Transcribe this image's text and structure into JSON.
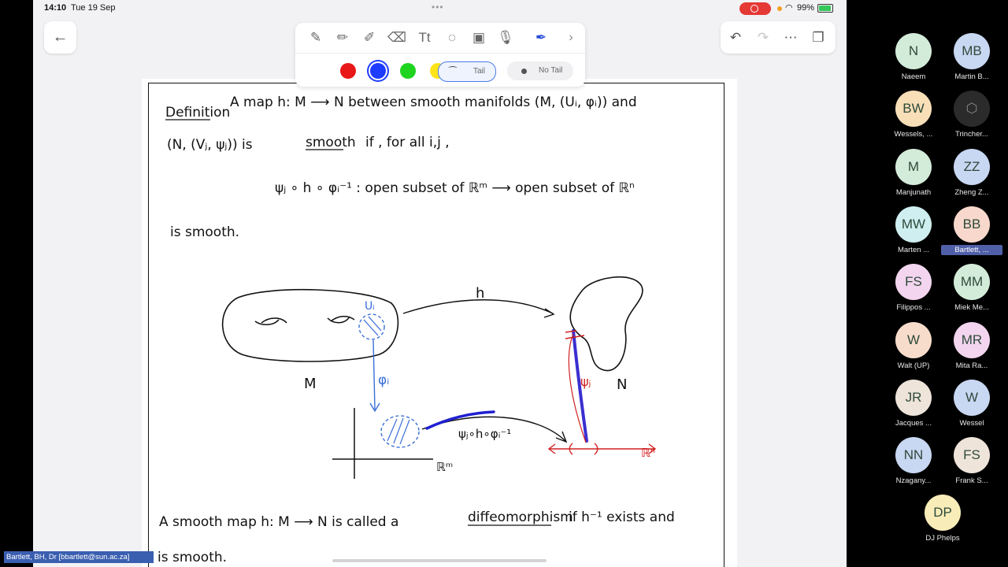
{
  "status_bar": {
    "time": "14:10",
    "date": "Tue 19 Sep",
    "battery": "99%",
    "colors": {
      "record": "#e53935",
      "battery": "#34c759",
      "dot": "#f4a020"
    }
  },
  "toolbar": {
    "tools": [
      {
        "name": "pen-icon",
        "glyph": "✎"
      },
      {
        "name": "pencil-icon",
        "glyph": "✏"
      },
      {
        "name": "highlighter-icon",
        "glyph": "✐"
      },
      {
        "name": "eraser-icon",
        "glyph": "⌫"
      },
      {
        "name": "text-tool-icon",
        "glyph": "Tt"
      },
      {
        "name": "lasso-icon",
        "glyph": "◌"
      },
      {
        "name": "image-icon",
        "glyph": "▣"
      },
      {
        "name": "microphone-icon",
        "glyph": "🎙"
      },
      {
        "name": "laser-pointer-icon",
        "glyph": "✒"
      }
    ],
    "next_glyph": "›",
    "colors": [
      "#e81818",
      "#1e3cff",
      "#1ed41e",
      "#ffe41a"
    ],
    "selected_color": "#1e3cff",
    "tail_label": "Tail",
    "no_tail_label": "No Tail"
  },
  "right_toolbar": {
    "undo": "↶",
    "redo": "↷",
    "more": "⋯",
    "pages": "❐"
  },
  "back_glyph": "←",
  "notes": {
    "definition_word": "Definition",
    "line1": "A map  h: M ⟶ N  between smooth manifolds  (M, (Uᵢ, φᵢ))  and",
    "line2_a": "(N, (Vⱼ, ψⱼ))  is",
    "line2_smooth": "smooth",
    "line2_b": "if , for all  i,j ,",
    "line3": "ψⱼ ∘ h ∘ φᵢ⁻¹  :  open subset of  ℝᵐ  ⟶  open subset of  ℝⁿ",
    "line4": "is smooth.",
    "label_h": "h",
    "label_Ui": "Uᵢ",
    "label_M": "M",
    "label_N": "N",
    "label_phi": "φᵢ",
    "label_psi": "ψⱼ",
    "label_comp": "ψⱼ∘h∘φᵢ⁻¹",
    "label_Rm": "ℝᵐ",
    "label_Rn": "ℝⁿ",
    "bottom_a": "A  smooth  map  h: M ⟶ N  is called a",
    "bottom_diffeo": "diffeomorphism",
    "bottom_b": "if  h⁻¹ exists and",
    "bottom_c": "is smooth."
  },
  "name_tag": "Bartlett, BH, Dr [bbartlett@sun.ac.za]",
  "participants": [
    {
      "initials": "N",
      "name": "Naeem",
      "color": "#d3ecd9"
    },
    {
      "initials": "MB",
      "name": "Martin B...",
      "color": "#c8d7f2"
    },
    {
      "initials": "BW",
      "name": "Wessels, ...",
      "color": "#f8dfb8"
    },
    {
      "initials": "",
      "name": "Trincher...",
      "color": "#2b2b2b"
    },
    {
      "initials": "M",
      "name": "Manjunath",
      "color": "#d3ecd9"
    },
    {
      "initials": "ZZ",
      "name": "Zheng Z...",
      "color": "#c8d7f2"
    },
    {
      "initials": "MW",
      "name": "Marten ...",
      "color": "#cfeef0"
    },
    {
      "initials": "BB",
      "name": "Bartlett, ...",
      "color": "#f8d8cc"
    },
    {
      "initials": "FS",
      "name": "Filippos ...",
      "color": "#f3d5ef"
    },
    {
      "initials": "MM",
      "name": "Miek Me...",
      "color": "#d3ecd9"
    },
    {
      "initials": "W",
      "name": "Walt (UP)",
      "color": "#f8dccb"
    },
    {
      "initials": "MR",
      "name": "Mita Ra...",
      "color": "#f3d5ef"
    },
    {
      "initials": "JR",
      "name": "Jacques ...",
      "color": "#eee4da"
    },
    {
      "initials": "W",
      "name": "Wessel",
      "color": "#c8d7f2"
    },
    {
      "initials": "NN",
      "name": "Nzagany...",
      "color": "#c8d7f2"
    },
    {
      "initials": "FS",
      "name": "Frank S...",
      "color": "#eee4da"
    },
    {
      "initials": "DP",
      "name": "DJ Phelps",
      "color": "#f8ecb8"
    }
  ]
}
